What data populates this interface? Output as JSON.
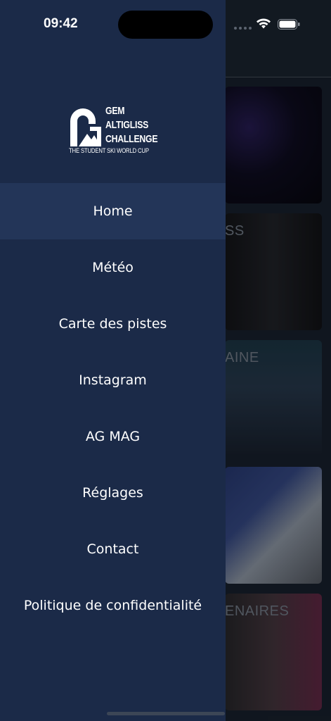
{
  "status_bar": {
    "time": "09:42"
  },
  "logo": {
    "line1": "GEM",
    "line2": "ALTIGLISS",
    "line3": "CHALLENGE",
    "tagline": "THE STUDENT SKI WORLD CUP"
  },
  "menu": {
    "items": [
      {
        "label": "Home",
        "active": true
      },
      {
        "label": "Météo"
      },
      {
        "label": "Carte des pistes"
      },
      {
        "label": "Instagram"
      },
      {
        "label": "AG MAG"
      },
      {
        "label": "Réglages"
      },
      {
        "label": "Contact"
      },
      {
        "label": "Politique de confidentialité"
      }
    ]
  },
  "background": {
    "card_texts": [
      "SS",
      "AINE",
      "ENAIRES"
    ]
  },
  "colors": {
    "drawer": "#1b2a48",
    "active_item": "#233558",
    "text": "#ffffff"
  }
}
